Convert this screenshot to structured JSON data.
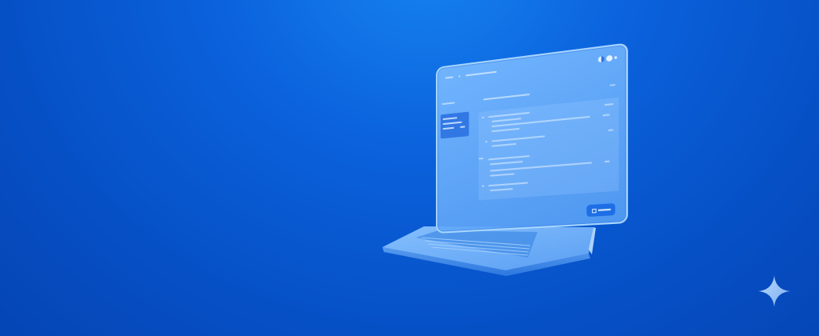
{
  "theme": {
    "background": "#0650c6",
    "screen_tint": "#78b9ff",
    "button_blue": "#1e6fe6",
    "sparkle": "#9cc8ff"
  },
  "icons": {
    "sparkle": "four-point-star-icon",
    "laptop": "laptop-illustration"
  }
}
